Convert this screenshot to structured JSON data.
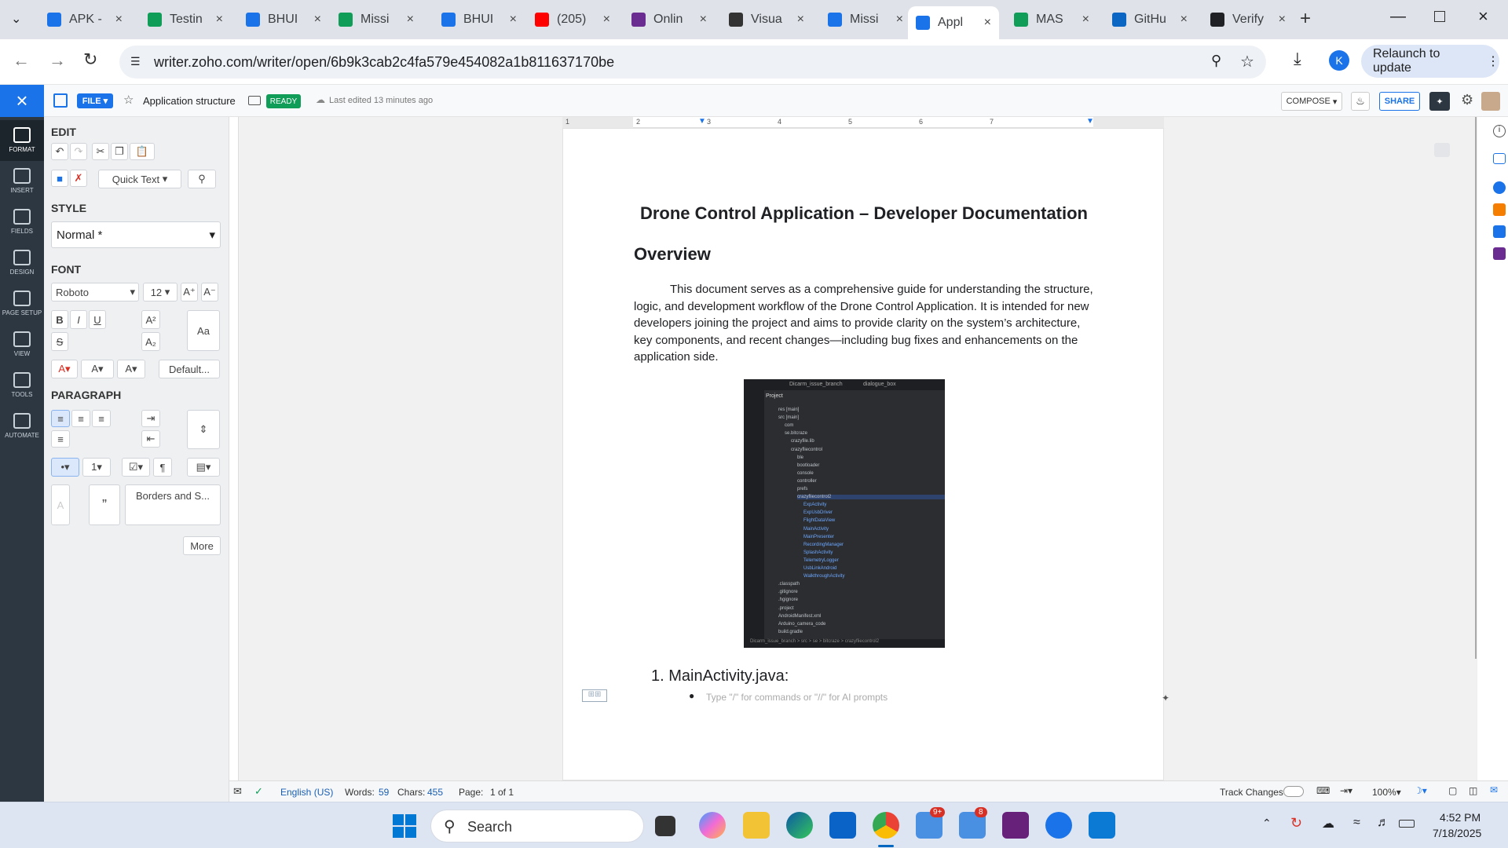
{
  "tabs": [
    {
      "label": "APK -",
      "color": "#1a73e8"
    },
    {
      "label": "Testin",
      "color": "#0f9d58"
    },
    {
      "label": "BHUI",
      "color": "#1a73e8"
    },
    {
      "label": "Missi",
      "color": "#0f9d58"
    },
    {
      "label": "BHUI",
      "color": "#1a73e8"
    },
    {
      "label": "(205)",
      "color": "#ff0000"
    },
    {
      "label": "Onlin",
      "color": "#6a2c91"
    },
    {
      "label": "Visua",
      "color": "#333333"
    },
    {
      "label": "Missi",
      "color": "#1a73e8"
    },
    {
      "label": "Appl",
      "color": "#1a73e8",
      "active": true
    },
    {
      "label": "MAS",
      "color": "#0f9d58"
    },
    {
      "label": "GitHu",
      "color": "#0a66c2"
    },
    {
      "label": "Verify",
      "color": "#202124"
    }
  ],
  "browser": {
    "url": "writer.zoho.com/writer/open/6b9k3cab2c4fa579e454082a1b811637170be",
    "relaunch": "Relaunch to update",
    "profile": "K"
  },
  "header": {
    "file_label": "FILE",
    "doc_name": "Application structure",
    "status": "READY",
    "last_edited": "Last edited 13 minutes ago",
    "compose": "COMPOSE",
    "share": "SHARE"
  },
  "rail": [
    "FORMAT",
    "INSERT",
    "FIELDS",
    "DESIGN",
    "PAGE SETUP",
    "VIEW",
    "TOOLS",
    "AUTOMATE"
  ],
  "format_panel": {
    "edit": "EDIT",
    "quick_text": "Quick Text",
    "style": "STYLE",
    "style_value": "Normal *",
    "font": "FONT",
    "font_family": "Roboto",
    "font_size": "12",
    "default_btn": "Default...",
    "paragraph": "PARAGRAPH",
    "borders": "Borders and S...",
    "more": "More"
  },
  "ruler_numbers": [
    "1",
    "2",
    "3",
    "4",
    "5",
    "6",
    "7"
  ],
  "document": {
    "title": "Drone Control Application – Developer Documentation",
    "heading": "Overview",
    "paragraph": "This document serves as a comprehensive guide for understanding the structure, logic, and development workflow of the Drone Control Application. It is intended for new developers joining the project and aims to provide clarity on the system’s architecture, key components, and recent changes—including bug fixes and enhancements on the application side.",
    "list_item": "1. MainActivity.java:",
    "placeholder": "Type \"/\" for commands or \"//\" for AI prompts"
  },
  "screenshot_tree": {
    "branch": "Dicarm_issue_branch",
    "dialogue": "dialogue_box",
    "project": "Project",
    "items": [
      "res [main]",
      "src [main]",
      "com",
      "se.bitcraze",
      "crazyfile.lib",
      "crazyfliecontrol",
      "ble",
      "bootloader",
      "console",
      "controller",
      "prefs",
      "crazyfliecontrol2",
      "ExpActivity",
      "ExpUsbDriver",
      "FlightDataView",
      "MainActivity",
      "MainPresenter",
      "RecordingManager",
      "SplashActivity",
      "TelemetryLogger",
      "UsbLinkAndroid",
      "WalkthroughActivity",
      ".classpath",
      ".gitignore",
      ".hgignore",
      ".project",
      "AndroidManifest.xml",
      "Arduino_camera_code",
      "build.gradle"
    ],
    "footer": "Dicarm_issue_branch > src > se > bitcraze > crazyfliecontrol2"
  },
  "status_bar": {
    "language": "English (US)",
    "words_label": "Words:",
    "words": "59",
    "chars_label": "Chars:",
    "chars": "455",
    "page_label": "Page:",
    "page": "1 of 1",
    "track_changes": "Track Changes",
    "zoom": "100%"
  },
  "taskbar": {
    "search": "Search",
    "time": "4:52 PM",
    "date": "7/18/2025",
    "mail_badge": "9+",
    "notif_badge": "8"
  }
}
